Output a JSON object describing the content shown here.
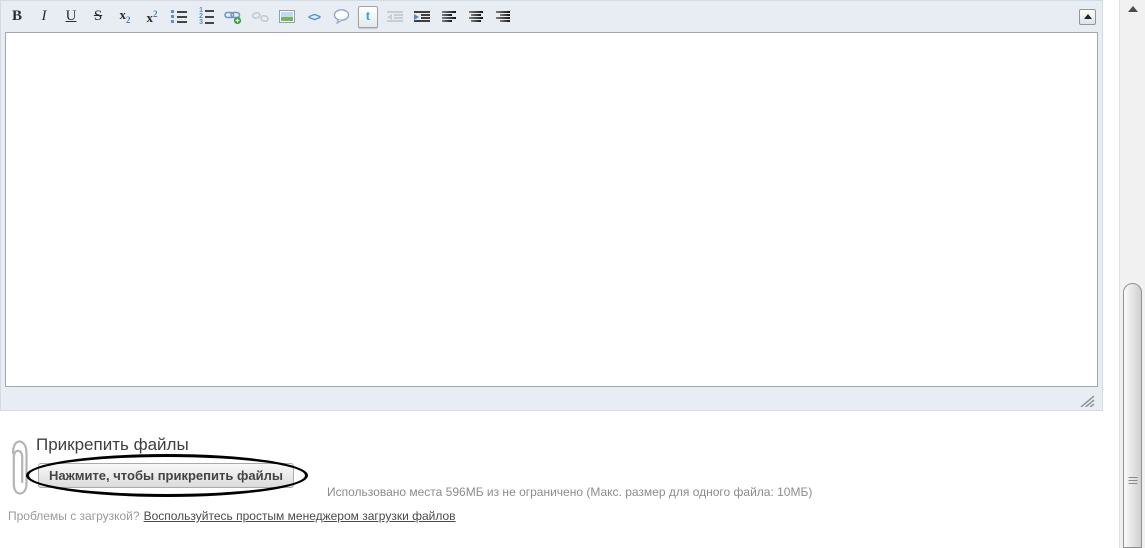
{
  "colors": {
    "toolbar_bg": "#e8edf3",
    "accent_blue": "#4a90d9",
    "list_blue": "#628cc9",
    "link_green": "#35a335",
    "annotation": "#000000",
    "grey_text": "#8c8c8c"
  },
  "editor": {
    "toolbar": {
      "bold": "B",
      "italic": "I",
      "underline": "U",
      "strikethrough": "S",
      "sub_base": "x",
      "sub_mark": "2",
      "sup_base": "x",
      "sup_mark": "2",
      "ordered_list_numbers": [
        "1",
        "2",
        "3"
      ],
      "code": "<>",
      "twitter": "t",
      "icons": [
        "bold",
        "italic",
        "underline",
        "strikethrough",
        "subscript",
        "superscript",
        "unordered-list",
        "ordered-list",
        "insert-link",
        "remove-link",
        "insert-image",
        "code",
        "quote",
        "twitter",
        "outdent",
        "indent",
        "align-left",
        "align-center",
        "align-right",
        "collapse-toolbar"
      ]
    },
    "body_text": ""
  },
  "scrollbar": {
    "orientation": "vertical",
    "thumb_position": "lower-half"
  },
  "attachments": {
    "heading": "Прикрепить файлы",
    "attach_button": "Нажмите, чтобы прикрепить файлы",
    "storage_info": "Использовано места 596МБ из не ограничено (Макс. размер для одного файла: 10МБ)",
    "problem_text": "Проблемы с загрузкой?",
    "manager_link": "Воспользуйтесь простым менеджером загрузки файлов"
  }
}
